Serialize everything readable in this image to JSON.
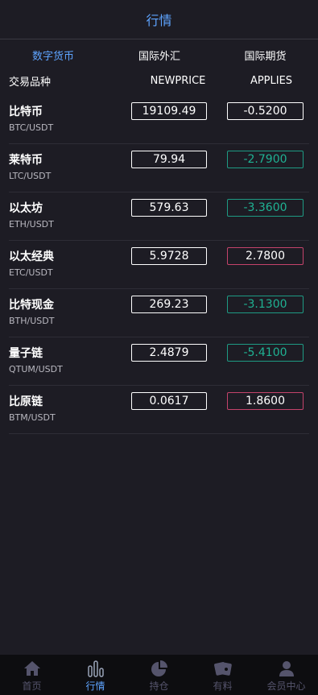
{
  "header": {
    "title": "行情"
  },
  "tabs": [
    {
      "label": "数字货币",
      "active": true
    },
    {
      "label": "国际外汇",
      "active": false
    },
    {
      "label": "国际期货",
      "active": false
    }
  ],
  "columns": {
    "name": "交易品种",
    "price": "NEWPRICE",
    "applies": "APPLIES"
  },
  "rows": [
    {
      "name": "比特币",
      "pair": "BTC/USDT",
      "price": "19109.49",
      "applies": "-0.5200",
      "trend": "neutral"
    },
    {
      "name": "莱特币",
      "pair": "LTC/USDT",
      "price": "79.94",
      "applies": "-2.7900",
      "trend": "down"
    },
    {
      "name": "以太坊",
      "pair": "ETH/USDT",
      "price": "579.63",
      "applies": "-3.3600",
      "trend": "down"
    },
    {
      "name": "以太经典",
      "pair": "ETC/USDT",
      "price": "5.9728",
      "applies": "2.7800",
      "trend": "up"
    },
    {
      "name": "比特现金",
      "pair": "BTH/USDT",
      "price": "269.23",
      "applies": "-3.1300",
      "trend": "down"
    },
    {
      "name": "量子链",
      "pair": "QTUM/USDT",
      "price": "2.4879",
      "applies": "-5.4100",
      "trend": "down"
    },
    {
      "name": "比原链",
      "pair": "BTM/USDT",
      "price": "0.0617",
      "applies": "1.8600",
      "trend": "up"
    }
  ],
  "nav": [
    {
      "label": "首页",
      "icon": "home-icon",
      "active": false
    },
    {
      "label": "行情",
      "icon": "market-chart-icon",
      "active": true
    },
    {
      "label": "持仓",
      "icon": "pie-chart-icon",
      "active": false
    },
    {
      "label": "有料",
      "icon": "cards-icon",
      "active": false
    },
    {
      "label": "会员中心",
      "icon": "user-icon",
      "active": false
    }
  ],
  "colors": {
    "accent": "#5ea4ff",
    "down": "#1fb293",
    "up": "#c4436b",
    "background": "#1d1c24"
  }
}
